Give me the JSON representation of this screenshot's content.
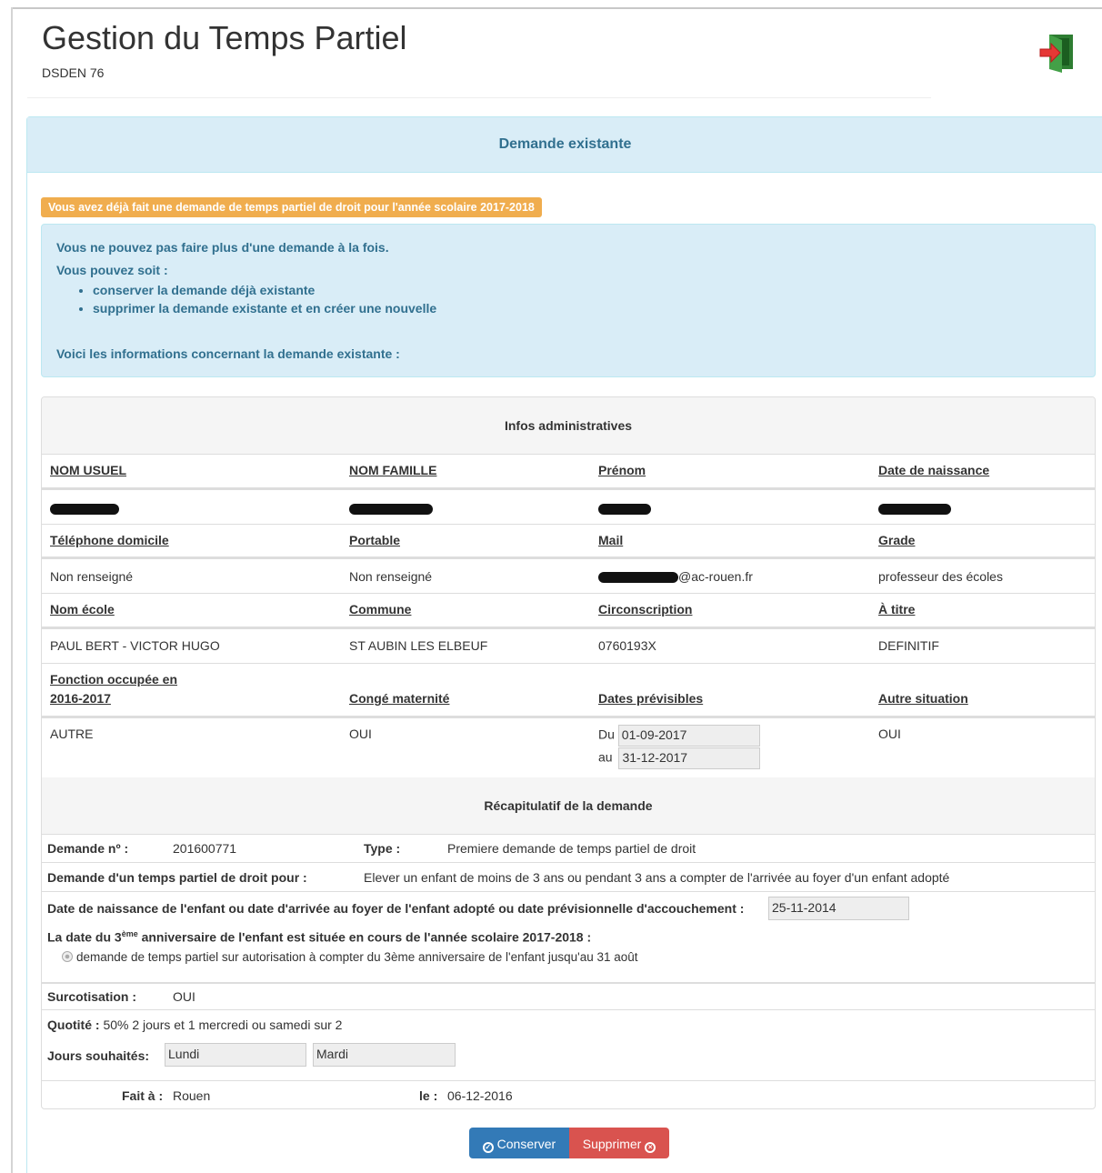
{
  "header": {
    "title": "Gestion du Temps Partiel",
    "subtitle": "DSDEN 76"
  },
  "panel": {
    "heading": "Demande existante"
  },
  "warning": "Vous avez déjà fait une demande de temps partiel de droit pour l'année scolaire 2017-2018",
  "info": {
    "line1": "Vous ne pouvez pas faire plus d'une demande à la fois.",
    "line2": "Vous pouvez soit :",
    "bullets": [
      "conserver la demande déjà existante",
      "supprimer la demande existante et en créer une nouvelle"
    ],
    "line3": "Voici les informations concernant la demande existante :"
  },
  "admin": {
    "heading": "Infos administratives",
    "row1_headers": [
      "NOM USUEL",
      "NOM FAMILLE",
      "Prénom",
      "Date de naissance"
    ],
    "row2_headers": [
      "Téléphone domicile",
      "Portable",
      "Mail",
      "Grade"
    ],
    "row2_values": [
      "Non renseigné",
      "Non renseigné",
      "@ac-rouen.fr",
      "professeur des écoles"
    ],
    "row3_headers": [
      "Nom école",
      "Commune",
      "Circonscription",
      "À titre"
    ],
    "row3_values": [
      "PAUL BERT - VICTOR HUGO",
      "ST AUBIN LES ELBEUF",
      "0760193X",
      "DEFINITIF"
    ],
    "row4_headers": [
      "Fonction occupée en",
      "2016-2017",
      "Congé maternité",
      "Dates prévisibles",
      "Autre situation"
    ],
    "row4_values": [
      "AUTRE",
      "OUI",
      "OUI"
    ],
    "dates": {
      "du_label": "Du",
      "du_value": "01-09-2017",
      "au_label": "au",
      "au_value": "31-12-2017"
    }
  },
  "recap": {
    "heading": "Récapitulatif de la demande",
    "demande_label": "Demande nº :",
    "demande_value": "201600771",
    "type_label": "Type :",
    "type_value": "Premiere demande de temps partiel de droit",
    "pour_label": "Demande d'un temps partiel de droit pour :",
    "pour_value": "Elever un enfant de moins de 3 ans ou pendant 3 ans a compter de l'arrivée au foyer d'un enfant adopté",
    "naissance_label": "Date de naissance de l'enfant ou date d'arrivée au foyer de l'enfant adopté ou date prévisionnelle d'accouchement :",
    "naissance_value": "25-11-2014",
    "anniv_label_pre": "La date du 3",
    "anniv_label_sup": "ème",
    "anniv_label_post": " anniversaire de l'enfant est située en cours de l'année scolaire 2017-2018 :",
    "radio_label": "demande de temps partiel sur autorisation à compter du 3ème anniversaire de l'enfant jusqu'au 31 août",
    "surcot_label": "Surcotisation :",
    "surcot_value": "OUI",
    "quotite_label": "Quotité :",
    "quotite_value": "50% 2 jours et 1 mercredi ou samedi sur 2",
    "jours_label": "Jours souhaités:",
    "jour1": "Lundi",
    "jour2": "Mardi",
    "fait_label": "Fait à :",
    "fait_value": "Rouen",
    "le_label": "le :",
    "le_value": "06-12-2016"
  },
  "buttons": {
    "conserver": "Conserver",
    "supprimer": "Supprimer"
  }
}
